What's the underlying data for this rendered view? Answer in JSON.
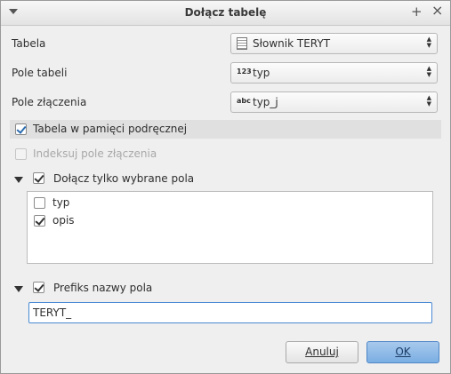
{
  "window": {
    "title": "Dołącz tabelę"
  },
  "form": {
    "tabela_label": "Tabela",
    "tabela_value": "Słownik TERYT",
    "pole_tabeli_label": "Pole tabeli",
    "pole_tabeli_type": "123",
    "pole_tabeli_value": "typ",
    "pole_zlaczenia_label": "Pole złączenia",
    "pole_zlaczenia_type": "abc",
    "pole_zlaczenia_value": "typ_j"
  },
  "options": {
    "cache_label": "Tabela w pamięci podręcznej",
    "cache_checked": true,
    "index_label": "Indeksuj pole złączenia",
    "index_checked": false
  },
  "fields_section": {
    "label": "Dołącz tylko wybrane pola",
    "checked": true,
    "items": [
      {
        "label": "typ",
        "checked": false
      },
      {
        "label": "opis",
        "checked": true
      }
    ]
  },
  "prefix_section": {
    "label": "Prefiks nazwy pola",
    "checked": true,
    "value": "TERYT_"
  },
  "buttons": {
    "cancel": "Anuluj",
    "ok": "OK"
  }
}
